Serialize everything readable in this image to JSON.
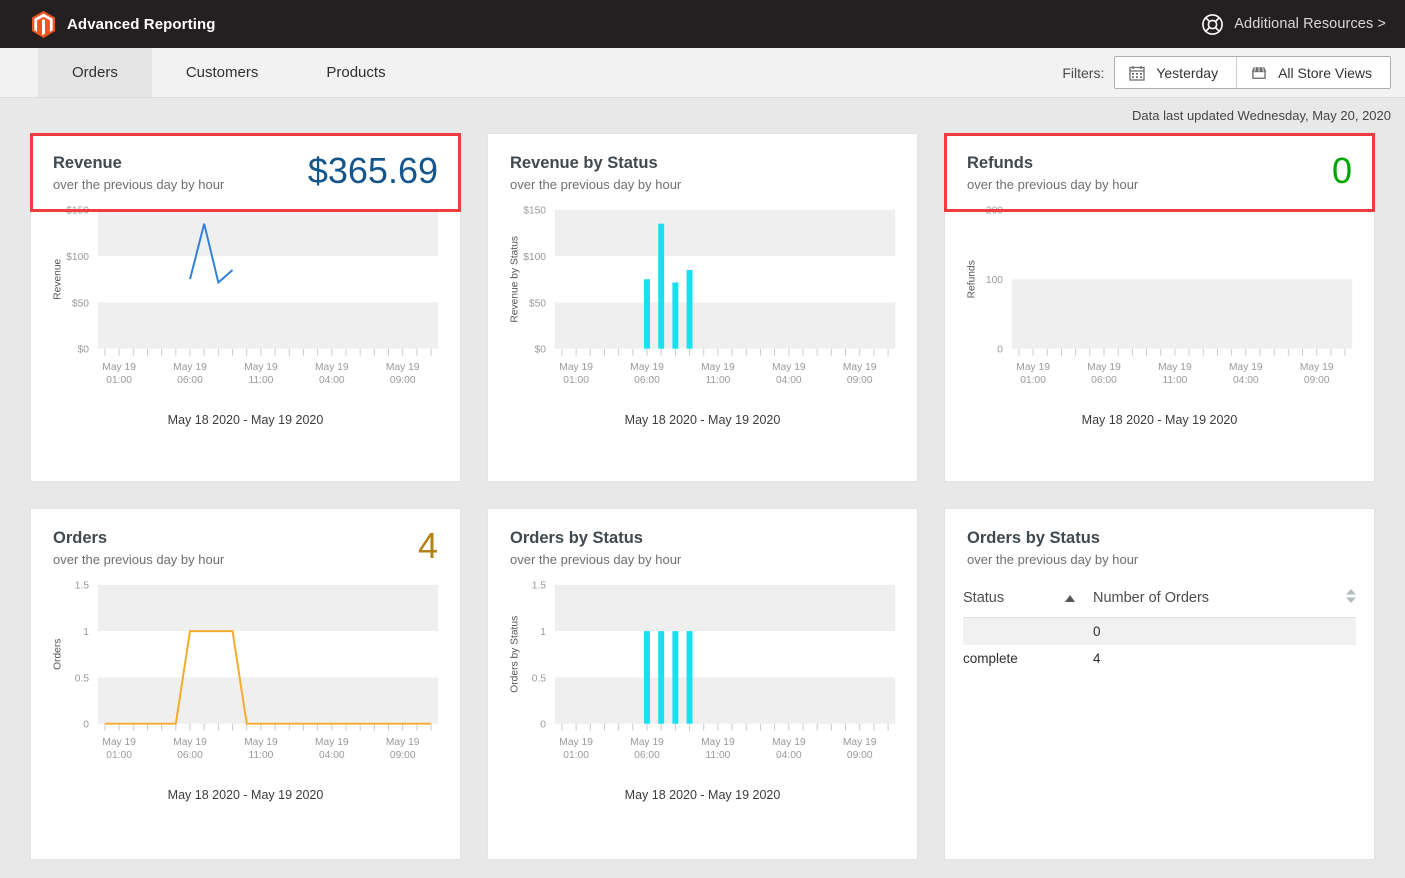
{
  "topbar": {
    "logo_icon": "magento-logo-icon",
    "title": "Advanced Reporting",
    "resources_icon": "life-ring-icon",
    "resources_label": "Additional Resources >"
  },
  "tabs": [
    {
      "label": "Orders",
      "active": true
    },
    {
      "label": "Customers",
      "active": false
    },
    {
      "label": "Products",
      "active": false
    }
  ],
  "filters": {
    "label": "Filters:",
    "date": {
      "icon": "calendar-icon",
      "label": "Yesterday"
    },
    "store": {
      "icon": "storefront-icon",
      "label": "All Store Views"
    }
  },
  "status": {
    "last_updated": "Data last updated Wednesday, May 20, 2020"
  },
  "cards": {
    "revenue": {
      "title": "Revenue",
      "subtitle": "over the previous day by hour",
      "kpi": "$365.69",
      "kpi_color": "#14568c",
      "highlighted": true,
      "range": "May 18 2020 - May 19 2020"
    },
    "revenue_by_status": {
      "title": "Revenue by Status",
      "subtitle": "over the previous day by hour",
      "kpi": "",
      "highlighted": false,
      "range": "May 18 2020 - May 19 2020"
    },
    "refunds": {
      "title": "Refunds",
      "subtitle": "over the previous day by hour",
      "kpi": "0",
      "kpi_color": "#00a400",
      "highlighted": true,
      "range": "May 18 2020 - May 19 2020"
    },
    "orders": {
      "title": "Orders",
      "subtitle": "over the previous day by hour",
      "kpi": "4",
      "kpi_color": "#b28217",
      "highlighted": false,
      "range": "May 18 2020 - May 19 2020"
    },
    "orders_by_status_chart": {
      "title": "Orders by Status",
      "subtitle": "over the previous day by hour",
      "kpi": "",
      "highlighted": false,
      "range": "May 18 2020 - May 19 2020"
    },
    "orders_by_status_table": {
      "title": "Orders by Status",
      "subtitle": "over the previous day by hour",
      "columns": [
        {
          "label": "Status",
          "sort": "asc",
          "sort_icon": "sort-ascending-icon"
        },
        {
          "label": "Number of Orders",
          "sort": "none",
          "sort_icon": "sort-both-icon"
        }
      ],
      "rows": [
        {
          "status": "",
          "orders": "0"
        },
        {
          "status": "complete",
          "orders": "4"
        }
      ]
    }
  },
  "chart_data": [
    {
      "id": "revenue",
      "type": "line",
      "title": "Revenue",
      "subtitle": "over the previous day by hour",
      "xlabel": "May 18 2020 - May 19 2020",
      "ylabel": "Revenue",
      "ylim": [
        0,
        150
      ],
      "yticks": [
        0,
        50,
        100,
        150
      ],
      "ytick_labels": [
        "$0",
        "$50",
        "$100",
        "$150"
      ],
      "xtick_labels": [
        "May 19\n01:00",
        "May 19\n06:00",
        "May 19\n11:00",
        "May 19\n04:00",
        "May 19\n09:00"
      ],
      "xtick_positions": [
        1,
        6,
        11,
        16,
        21
      ],
      "n_ticks": 24,
      "grid": false,
      "band_color": "#efefef",
      "line_color": "#2f80d8",
      "points": [
        {
          "x": 6,
          "y": 75.0
        },
        {
          "x": 7,
          "y": 135.0
        },
        {
          "x": 8,
          "y": 71.5
        },
        {
          "x": 9,
          "y": 85.0
        }
      ]
    },
    {
      "id": "revenue_by_status",
      "type": "bar",
      "title": "Revenue by Status",
      "subtitle": "over the previous day by hour",
      "xlabel": "May 18 2020 - May 19 2020",
      "ylabel": "Revenue by Status",
      "ylim": [
        0,
        150
      ],
      "yticks": [
        0,
        50,
        100,
        150
      ],
      "ytick_labels": [
        "$0",
        "$50",
        "$100",
        "$150"
      ],
      "xtick_labels": [
        "May 19\n01:00",
        "May 19\n06:00",
        "May 19\n11:00",
        "May 19\n04:00",
        "May 19\n09:00"
      ],
      "xtick_positions": [
        1,
        6,
        11,
        16,
        21
      ],
      "n_ticks": 24,
      "grid": false,
      "band_color": "#efefef",
      "bar_color": "#19e0ef",
      "bars": [
        {
          "x": 6,
          "value": 75.0
        },
        {
          "x": 7,
          "value": 135.0
        },
        {
          "x": 8,
          "value": 71.5
        },
        {
          "x": 9,
          "value": 85.0
        }
      ]
    },
    {
      "id": "refunds",
      "type": "bar",
      "title": "Refunds",
      "subtitle": "over the previous day by hour",
      "xlabel": "May 18 2020 - May 19 2020",
      "ylabel": "Refunds",
      "ylim": [
        0,
        200
      ],
      "yticks": [
        0,
        100,
        200
      ],
      "ytick_labels": [
        "0",
        "100",
        "200"
      ],
      "xtick_labels": [
        "May 19\n01:00",
        "May 19\n06:00",
        "May 19\n11:00",
        "May 19\n04:00",
        "May 19\n09:00"
      ],
      "xtick_positions": [
        1,
        6,
        11,
        16,
        21
      ],
      "n_ticks": 24,
      "grid": false,
      "band_color": "#efefef",
      "bar_color": "#19e0ef",
      "bars": []
    },
    {
      "id": "orders",
      "type": "line",
      "title": "Orders",
      "subtitle": "over the previous day by hour",
      "xlabel": "May 18 2020 - May 19 2020",
      "ylabel": "Orders",
      "ylim": [
        0,
        1.5
      ],
      "yticks": [
        0,
        0.5,
        1,
        1.5
      ],
      "ytick_labels": [
        "0",
        "0.5",
        "1",
        "1.5"
      ],
      "xtick_labels": [
        "May 19\n01:00",
        "May 19\n06:00",
        "May 19\n11:00",
        "May 19\n04:00",
        "May 19\n09:00"
      ],
      "xtick_positions": [
        1,
        6,
        11,
        16,
        21
      ],
      "n_ticks": 24,
      "grid": false,
      "band_color": "#efefef",
      "line_color": "#f5ab2a",
      "points": [
        {
          "x": 0,
          "y": 0
        },
        {
          "x": 1,
          "y": 0
        },
        {
          "x": 2,
          "y": 0
        },
        {
          "x": 3,
          "y": 0
        },
        {
          "x": 4,
          "y": 0
        },
        {
          "x": 5,
          "y": 0
        },
        {
          "x": 6,
          "y": 1
        },
        {
          "x": 7,
          "y": 1
        },
        {
          "x": 8,
          "y": 1
        },
        {
          "x": 9,
          "y": 1
        },
        {
          "x": 10,
          "y": 0
        },
        {
          "x": 11,
          "y": 0
        },
        {
          "x": 12,
          "y": 0
        },
        {
          "x": 13,
          "y": 0
        },
        {
          "x": 14,
          "y": 0
        },
        {
          "x": 15,
          "y": 0
        },
        {
          "x": 16,
          "y": 0
        },
        {
          "x": 17,
          "y": 0
        },
        {
          "x": 18,
          "y": 0
        },
        {
          "x": 19,
          "y": 0
        },
        {
          "x": 20,
          "y": 0
        },
        {
          "x": 21,
          "y": 0
        },
        {
          "x": 22,
          "y": 0
        },
        {
          "x": 23,
          "y": 0
        }
      ]
    },
    {
      "id": "orders_by_status",
      "type": "bar",
      "title": "Orders by Status",
      "subtitle": "over the previous day by hour",
      "xlabel": "May 18 2020 - May 19 2020",
      "ylabel": "Orders by Status",
      "ylim": [
        0,
        1.5
      ],
      "yticks": [
        0,
        0.5,
        1,
        1.5
      ],
      "ytick_labels": [
        "0",
        "0.5",
        "1",
        "1.5"
      ],
      "xtick_labels": [
        "May 19\n01:00",
        "May 19\n06:00",
        "May 19\n11:00",
        "May 19\n04:00",
        "May 19\n09:00"
      ],
      "xtick_positions": [
        1,
        6,
        11,
        16,
        21
      ],
      "n_ticks": 24,
      "grid": false,
      "band_color": "#efefef",
      "bar_color": "#19e0ef",
      "bars": [
        {
          "x": 6,
          "value": 1
        },
        {
          "x": 7,
          "value": 1
        },
        {
          "x": 8,
          "value": 1
        },
        {
          "x": 9,
          "value": 1
        }
      ]
    },
    {
      "id": "orders_by_status_table",
      "type": "table",
      "title": "Orders by Status",
      "columns": [
        "Status",
        "Number of Orders"
      ],
      "rows": [
        [
          "",
          "0"
        ],
        [
          "complete",
          "4"
        ]
      ]
    }
  ]
}
